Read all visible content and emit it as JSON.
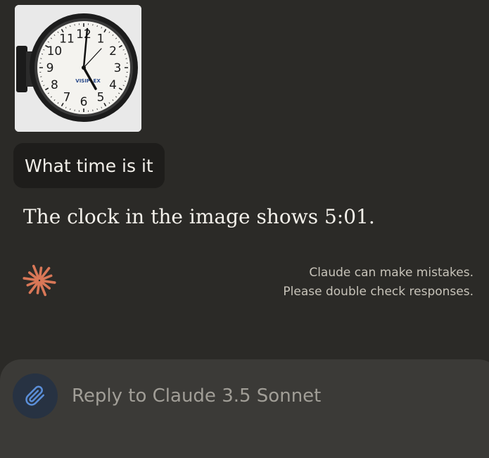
{
  "conversation": {
    "attachment": {
      "kind": "image",
      "clock": {
        "brand": "VISIPLEX",
        "numerals": [
          "12",
          "1",
          "2",
          "3",
          "4",
          "5",
          "6",
          "7",
          "8",
          "9",
          "10",
          "11"
        ]
      }
    },
    "user_message": "What time is it",
    "assistant_message": "The clock in the image shows 5:01."
  },
  "footer": {
    "logo_icon": "claude-spark-icon",
    "logo_color": "#d97757",
    "disclaimer_line1": "Claude can make mistakes.",
    "disclaimer_line2": "Please double check responses."
  },
  "composer": {
    "attach_icon": "paperclip-icon",
    "attach_icon_color": "#5b8fd9",
    "placeholder": "Reply to Claude 3.5 Sonnet",
    "value": ""
  }
}
